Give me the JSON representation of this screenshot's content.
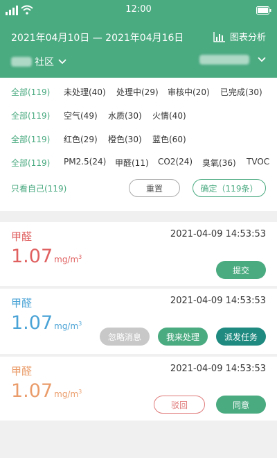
{
  "colors": {
    "primary": "#4aaa80",
    "teal": "#1f8a80",
    "red": "#e06060",
    "blue": "#4aa3d6",
    "orange": "#ea9c6a"
  },
  "status_bar": {
    "time": "12:00"
  },
  "header": {
    "date_range": "2021年04月10日 — 2021年04月16日",
    "chart_label": "图表分析",
    "community_label": "社区"
  },
  "filters": {
    "rows": [
      [
        "全部(119)",
        "未处理(40)",
        "处理中(29)",
        "审核中(20)",
        "已完成(30)"
      ],
      [
        "全部(119)",
        "空气(49)",
        "水质(30)",
        "火情(40)"
      ],
      [
        "全部(119)",
        "红色(29)",
        "橙色(30)",
        "蓝色(60)"
      ],
      [
        "全部(119)",
        "PM2.5(24)",
        "甲醛(11)",
        "CO2(24)",
        "臭氧(36)",
        "TVOC"
      ]
    ],
    "self_only": "只看自己(119)",
    "reset": "重置",
    "confirm": "确定（119条）"
  },
  "cards": [
    {
      "title": "甲醛",
      "time": "2021-04-09  14:53:53",
      "value": "1.07",
      "unit": "mg/m",
      "unit_sup": "3",
      "actions": [
        "提交"
      ]
    },
    {
      "title": "甲醛",
      "time": "2021-04-09  14:53:53",
      "value": "1.07",
      "unit": "mg/m",
      "unit_sup": "3",
      "actions": [
        "忽略消息",
        "我来处理",
        "派发任务"
      ]
    },
    {
      "title": "甲醛",
      "time": "2021-04-09  14:53:53",
      "value": "1.07",
      "unit": "mg/m",
      "unit_sup": "3",
      "actions": [
        "驳回",
        "同意"
      ]
    }
  ]
}
